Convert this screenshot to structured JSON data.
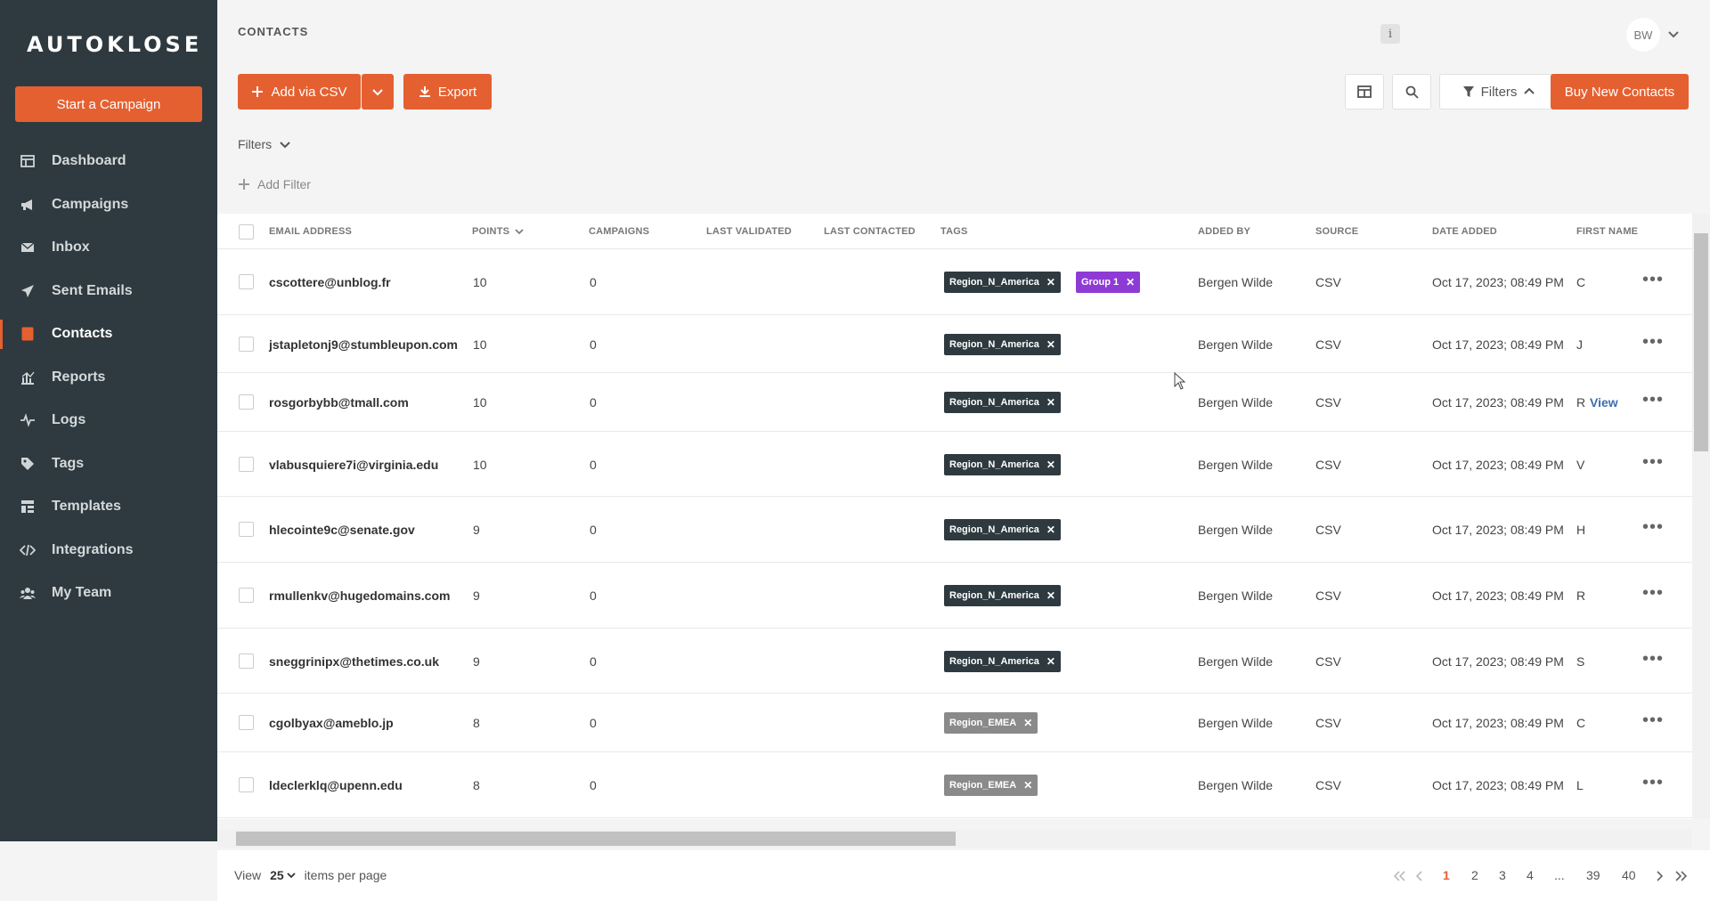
{
  "app": {
    "logo": "AUTOKLOSE",
    "cta": "Start a Campaign"
  },
  "nav": [
    {
      "label": "Dashboard",
      "icon": "dashboard-icon"
    },
    {
      "label": "Campaigns",
      "icon": "megaphone-icon"
    },
    {
      "label": "Inbox",
      "icon": "envelope-icon"
    },
    {
      "label": "Sent Emails",
      "icon": "paper-plane-icon"
    },
    {
      "label": "Contacts",
      "icon": "contact-book-icon",
      "active": true
    },
    {
      "label": "Reports",
      "icon": "bar-chart-icon"
    },
    {
      "label": "Logs",
      "icon": "pulse-icon"
    },
    {
      "label": "Tags",
      "icon": "tag-icon"
    },
    {
      "label": "Templates",
      "icon": "template-icon"
    },
    {
      "label": "Integrations",
      "icon": "code-icon"
    },
    {
      "label": "My Team",
      "icon": "users-icon"
    }
  ],
  "header": {
    "title": "CONTACTS",
    "info": "i",
    "avatar": "BW"
  },
  "toolbar": {
    "add_csv": "Add via CSV",
    "export": "Export",
    "filters": "Filters",
    "buy": "Buy New Contacts"
  },
  "filters": {
    "label": "Filters",
    "add": "Add Filter"
  },
  "columns": {
    "email": "EMAIL ADDRESS",
    "points": "POINTS",
    "campaigns": "CAMPAIGNS",
    "last_validated": "LAST VALIDATED",
    "last_contacted": "LAST CONTACTED",
    "tags": "TAGS",
    "added_by": "ADDED BY",
    "source": "SOURCE",
    "date_added": "DATE ADDED",
    "first_name": "FIRST NAME"
  },
  "rows": [
    {
      "email": "cscottere@unblog.fr",
      "points": "10",
      "campaigns": "0",
      "tags": [
        {
          "label": "Region_N_America",
          "color": "#2e3a3f"
        },
        {
          "label": "Group 1",
          "color": "#8e3bd6"
        }
      ],
      "added_by": "Bergen Wilde",
      "source": "CSV",
      "date": "Oct 17, 2023; 08:49 PM",
      "first": "C"
    },
    {
      "email": "jstapletonj9@stumbleupon.com",
      "points": "10",
      "campaigns": "0",
      "tags": [
        {
          "label": "Region_N_America",
          "color": "#2e3a3f"
        }
      ],
      "added_by": "Bergen Wilde",
      "source": "CSV",
      "date": "Oct 17, 2023; 08:49 PM",
      "first": "J"
    },
    {
      "email": "rosgorbybb@tmall.com",
      "points": "10",
      "campaigns": "0",
      "tags": [
        {
          "label": "Region_N_America",
          "color": "#2e3a3f"
        }
      ],
      "added_by": "Bergen Wilde",
      "source": "CSV",
      "date": "Oct 17, 2023; 08:49 PM",
      "first": "R",
      "view": "View"
    },
    {
      "email": "vlabusquiere7i@virginia.edu",
      "points": "10",
      "campaigns": "0",
      "tags": [
        {
          "label": "Region_N_America",
          "color": "#2e3a3f"
        }
      ],
      "added_by": "Bergen Wilde",
      "source": "CSV",
      "date": "Oct 17, 2023; 08:49 PM",
      "first": "V"
    },
    {
      "email": "hlecointe9c@senate.gov",
      "points": "9",
      "campaigns": "0",
      "tags": [
        {
          "label": "Region_N_America",
          "color": "#2e3a3f"
        }
      ],
      "added_by": "Bergen Wilde",
      "source": "CSV",
      "date": "Oct 17, 2023; 08:49 PM",
      "first": "H"
    },
    {
      "email": "rmullenkv@hugedomains.com",
      "points": "9",
      "campaigns": "0",
      "tags": [
        {
          "label": "Region_N_America",
          "color": "#2e3a3f"
        }
      ],
      "added_by": "Bergen Wilde",
      "source": "CSV",
      "date": "Oct 17, 2023; 08:49 PM",
      "first": "R"
    },
    {
      "email": "sneggrinipx@thetimes.co.uk",
      "points": "9",
      "campaigns": "0",
      "tags": [
        {
          "label": "Region_N_America",
          "color": "#2e3a3f"
        }
      ],
      "added_by": "Bergen Wilde",
      "source": "CSV",
      "date": "Oct 17, 2023; 08:49 PM",
      "first": "S"
    },
    {
      "email": "cgolbyax@ameblo.jp",
      "points": "8",
      "campaigns": "0",
      "tags": [
        {
          "label": "Region_EMEA",
          "color": "#8a8a8a"
        }
      ],
      "added_by": "Bergen Wilde",
      "source": "CSV",
      "date": "Oct 17, 2023; 08:49 PM",
      "first": "C"
    },
    {
      "email": "ldeclerklq@upenn.edu",
      "points": "8",
      "campaigns": "0",
      "tags": [
        {
          "label": "Region_EMEA",
          "color": "#8a8a8a"
        }
      ],
      "added_by": "Bergen Wilde",
      "source": "CSV",
      "date": "Oct 17, 2023; 08:49 PM",
      "first": "L"
    }
  ],
  "footer": {
    "view": "View",
    "per_page": "25",
    "items_per_page": "items per page",
    "pages": [
      "1",
      "2",
      "3",
      "4",
      "...",
      "39",
      "40"
    ],
    "current_page": "1"
  }
}
